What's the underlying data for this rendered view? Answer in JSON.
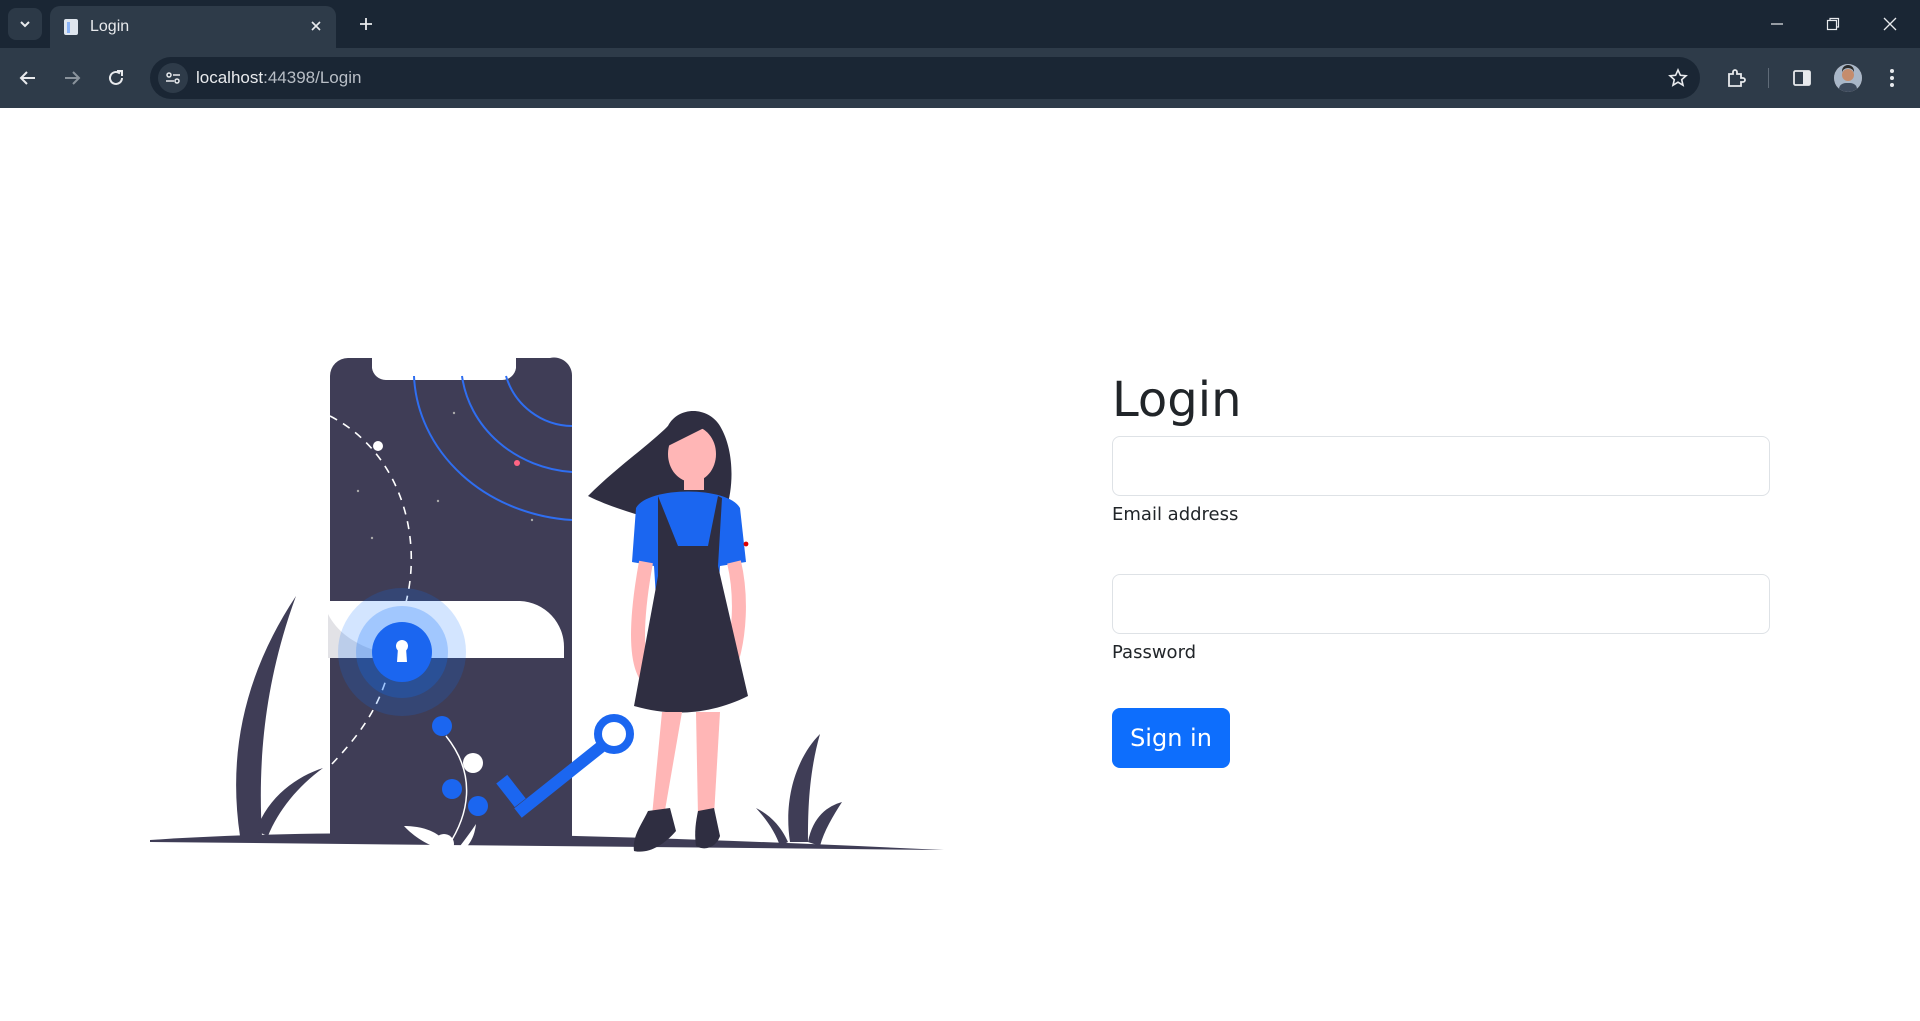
{
  "browser": {
    "tab_title": "Login",
    "url_host": "localhost",
    "url_rest": ":44398/Login"
  },
  "login": {
    "title": "Login",
    "email_value": "",
    "email_label": "Email address",
    "password_value": "",
    "password_label": "Password",
    "signin_label": "Sign in"
  },
  "colors": {
    "accent": "#0d6efd",
    "illustration_dark": "#3f3d56",
    "skin": "#ffb6b6",
    "chrome_dark": "#1a2634",
    "chrome_light": "#2e3b49"
  }
}
